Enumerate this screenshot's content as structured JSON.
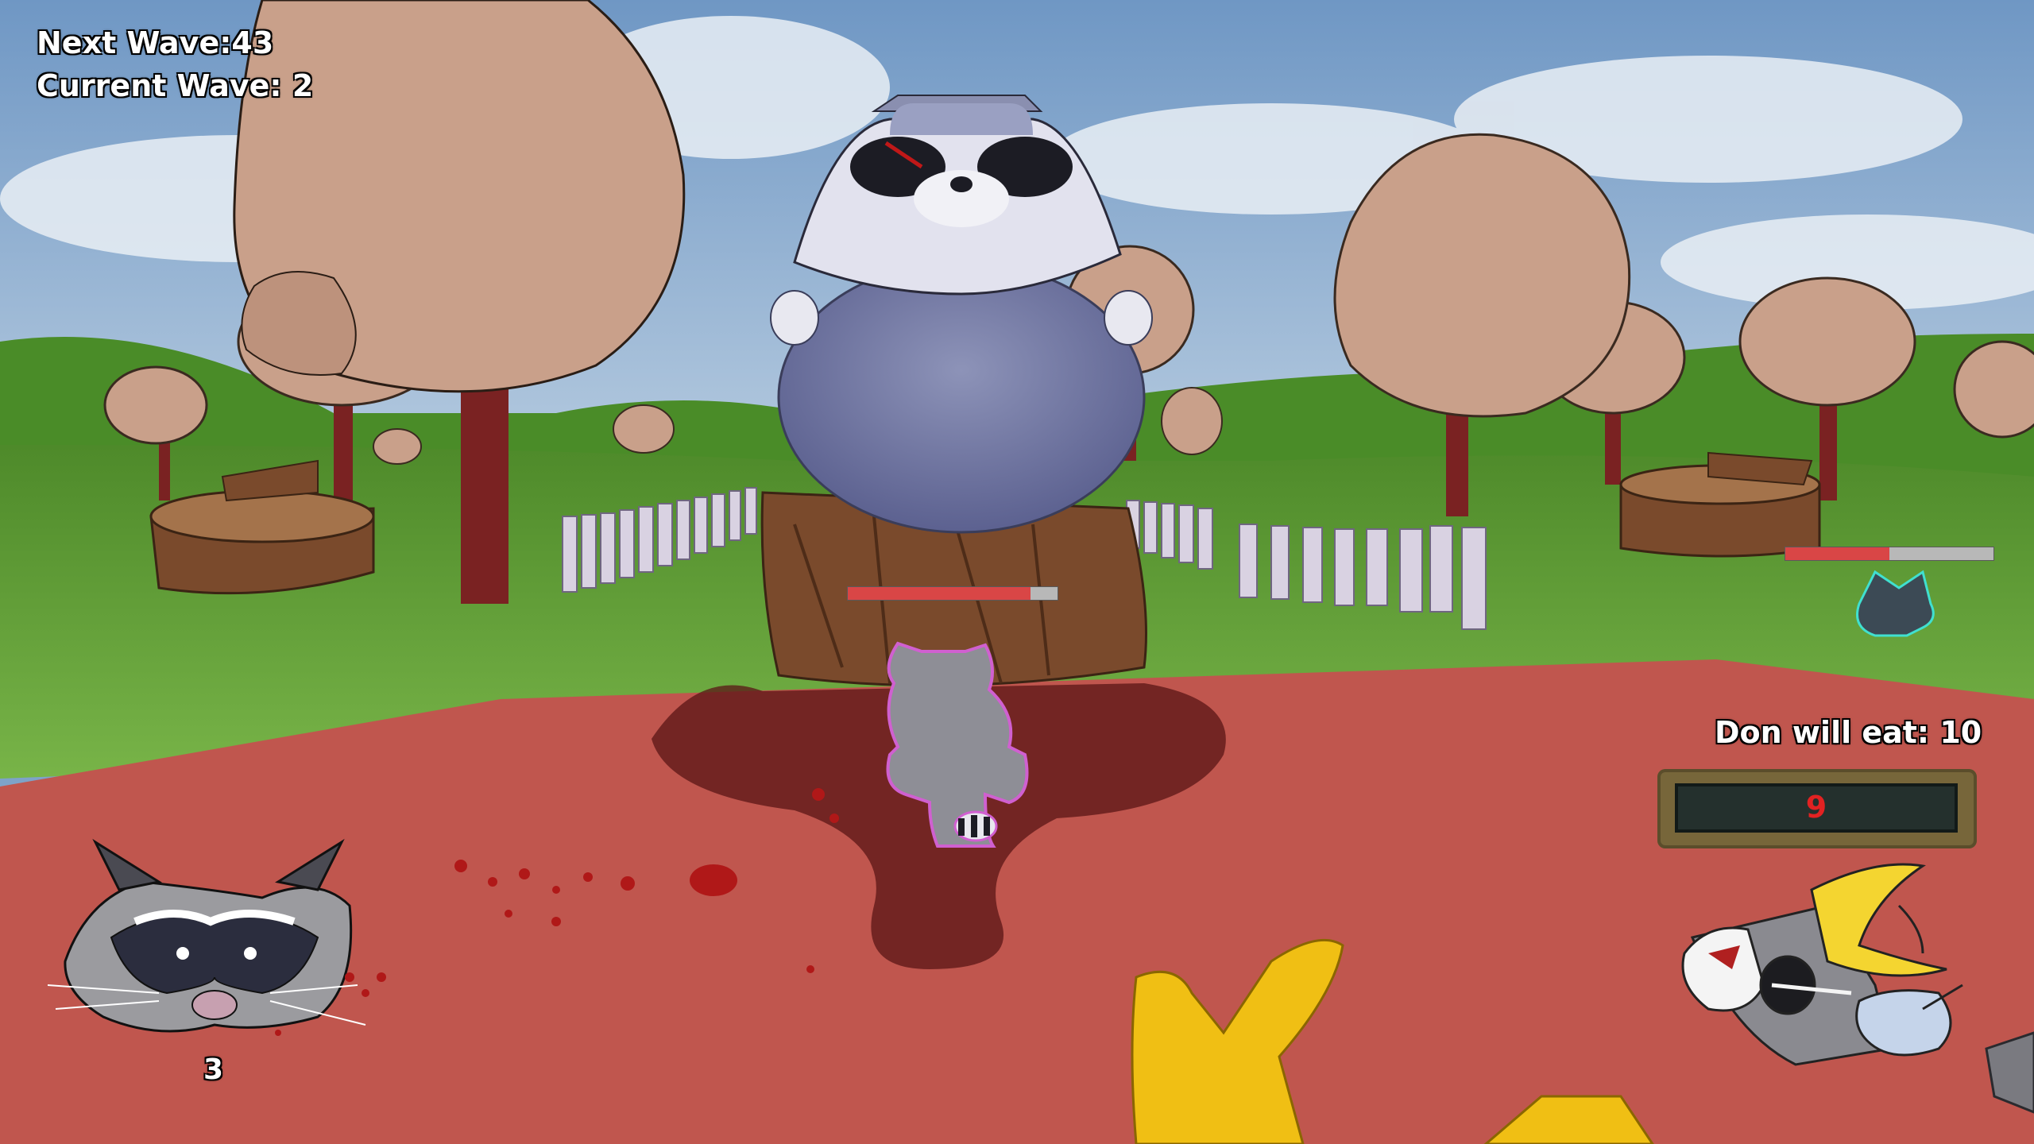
{
  "hud": {
    "next_wave": "Next Wave:43",
    "current_wave": "Current Wave: 2",
    "lives": "3",
    "eat_label": "Don will eat: 10",
    "eat_count": "9"
  },
  "boss": {
    "health_fraction": 0.87
  },
  "enemy": {
    "health_fraction": 0.5
  },
  "colors": {
    "health_fill": "#d94646",
    "health_bg": "#b8b8b8",
    "eat_counter": "#e22222",
    "ground_red": "#c0564e",
    "grass": "#5f9a35",
    "tree_canopy": "#c9a08a",
    "trunk": "#7a2222"
  },
  "icons": {
    "raccoon_portrait": "raccoon-face-icon",
    "inventory": "food-pile-icon"
  }
}
